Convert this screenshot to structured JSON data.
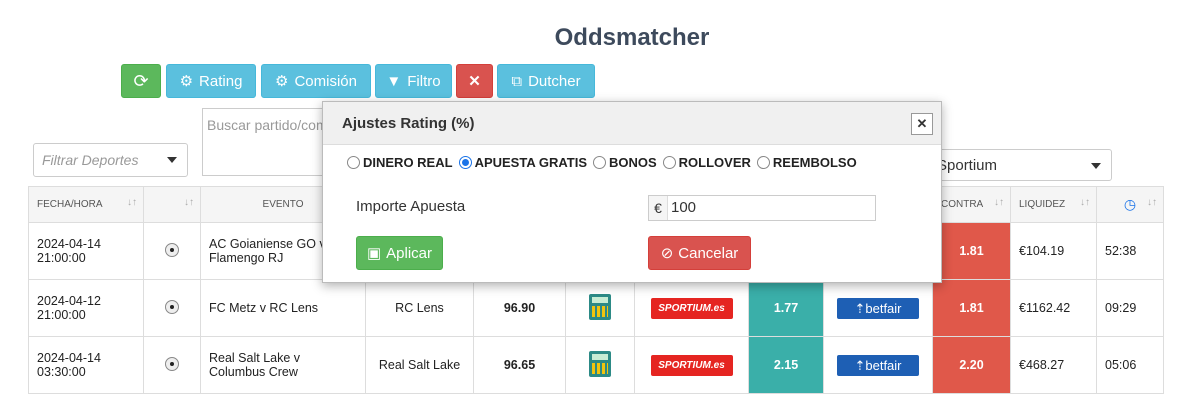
{
  "page": {
    "title": "Oddsmatcher"
  },
  "toolbar": {
    "refresh_icon": "refresh-icon",
    "rating": "Rating",
    "commission": "Comisión",
    "filter": "Filtro",
    "clear_icon": "close-icon",
    "dutcher": "Dutcher",
    "colors": {
      "green": "#5cb85c",
      "info": "#5bc0de",
      "red": "#d9534f"
    }
  },
  "search": {
    "placeholder": "Buscar partido/competición"
  },
  "sport_filter": {
    "placeholder": "Filtrar Deportes"
  },
  "bookie_select": {
    "value": "Sportium"
  },
  "table": {
    "headers": [
      "FECHA/HORA",
      "",
      "EVENTO",
      "CONTRA",
      "LIQUIDEZ"
    ],
    "rows": [
      {
        "date": "2024-04-14",
        "time": "21:00:00",
        "event": "AC Goianiense GO v Flamengo RJ",
        "pick": "",
        "rating": "",
        "back": "",
        "lay": "1.81",
        "liquidity": "€104.19",
        "timer": "52:38"
      },
      {
        "date": "2024-04-12",
        "time": "21:00:00",
        "event": "FC Metz v RC Lens",
        "pick": "RC Lens",
        "rating": "96.90",
        "bookie": "SPORTIUM.es",
        "back": "1.77",
        "exchange": "betfair",
        "lay": "1.81",
        "liquidity": "€1162.42",
        "timer": "09:29"
      },
      {
        "date": "2024-04-14",
        "time": "03:30:00",
        "event": "Real Salt Lake v Columbus Crew",
        "pick": "Real Salt Lake",
        "rating": "96.65",
        "bookie": "SPORTIUM.es",
        "back": "2.15",
        "exchange": "betfair",
        "lay": "2.20",
        "liquidity": "€468.27",
        "timer": "05:06"
      }
    ]
  },
  "modal": {
    "title": "Ajustes Rating (%)",
    "options": [
      "DINERO REAL",
      "APUESTA GRATIS",
      "BONOS",
      "ROLLOVER",
      "REEMBOLSO"
    ],
    "selected": "APUESTA GRATIS",
    "amount_label": "Importe Apuesta",
    "currency": "€",
    "amount": "100",
    "apply": "Aplicar",
    "cancel": "Cancelar"
  }
}
